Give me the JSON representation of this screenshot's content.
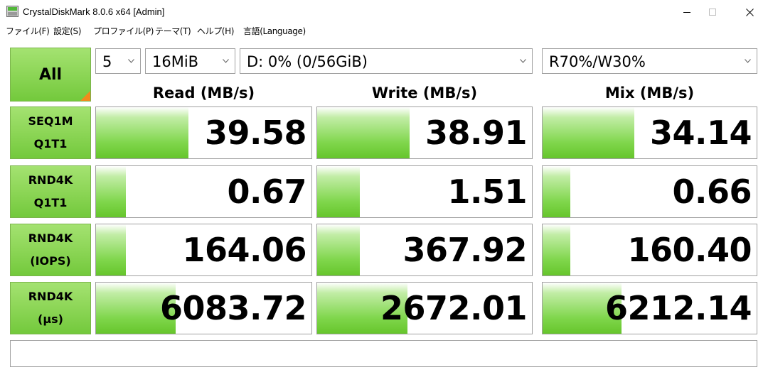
{
  "window": {
    "title": "CrystalDiskMark 8.0.6 x64 [Admin]"
  },
  "menu": [
    "ファイル(F)",
    "設定(S)",
    "プロファイル(P)",
    "テーマ(T)",
    "ヘルプ(H)",
    "言語(Language)"
  ],
  "controls": {
    "all_label": "All",
    "count": "5",
    "size": "16MiB",
    "drive": "D: 0% (0/56GiB)",
    "mix": "R70%/W30%"
  },
  "headers": {
    "read": "Read (MB/s)",
    "write": "Write (MB/s)",
    "mix": "Mix (MB/s)"
  },
  "rows": [
    {
      "line1": "SEQ1M",
      "line2": "Q1T1",
      "read": "39.58",
      "write": "38.91",
      "mix": "34.14",
      "read_fill": 0.43,
      "write_fill": 0.43,
      "mix_fill": 0.43
    },
    {
      "line1": "RND4K",
      "line2": "Q1T1",
      "read": "0.67",
      "write": "1.51",
      "mix": "0.66",
      "read_fill": 0.14,
      "write_fill": 0.2,
      "mix_fill": 0.13
    },
    {
      "line1": "RND4K",
      "line2": "(IOPS)",
      "read": "164.06",
      "write": "367.92",
      "mix": "160.40",
      "read_fill": 0.14,
      "write_fill": 0.2,
      "mix_fill": 0.13
    },
    {
      "line1": "RND4K",
      "line2": "(µs)",
      "read": "6083.72",
      "write": "2672.01",
      "mix": "6212.14",
      "read_fill": 0.37,
      "write_fill": 0.42,
      "mix_fill": 0.37
    }
  ],
  "comment": "",
  "colors": {
    "accent_green": "#8fd759",
    "all_corner": "#f28a1c"
  },
  "icons": {
    "app": "crystaldiskmark-app-icon",
    "minimize": "minimize-icon",
    "maximize": "maximize-icon",
    "close": "close-icon",
    "dropdown": "chevron-down-icon"
  }
}
